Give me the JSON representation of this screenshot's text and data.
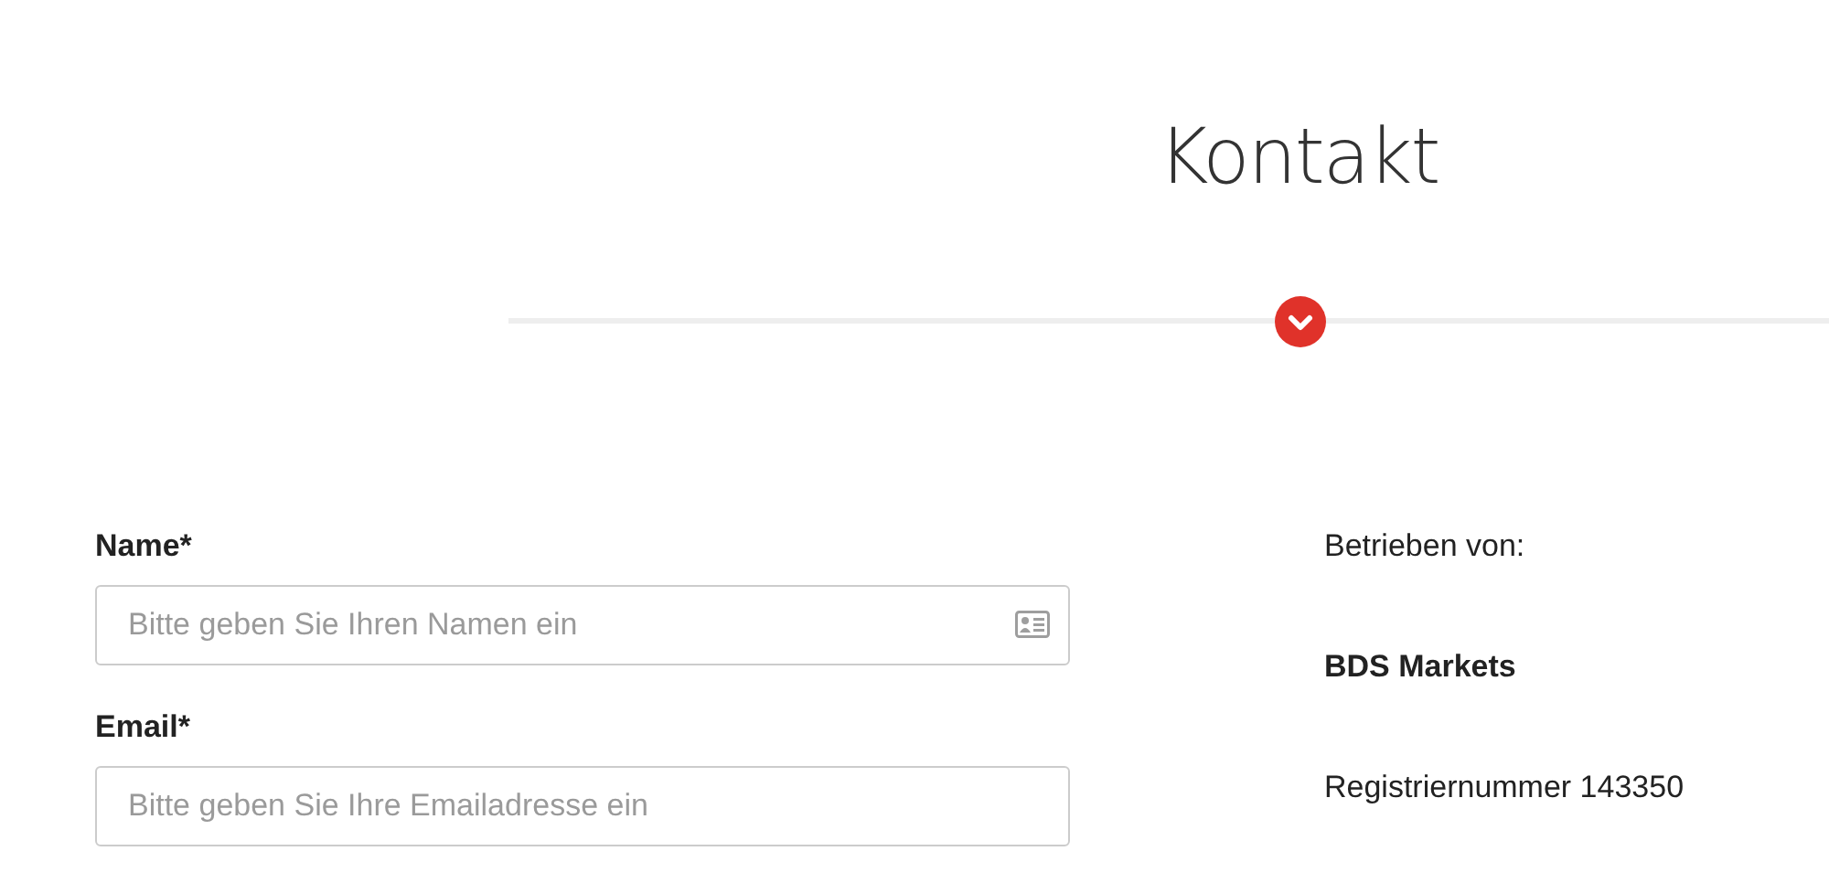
{
  "heading": "Kontakt",
  "form": {
    "fields": [
      {
        "label": "Name*",
        "placeholder": "Bitte geben Sie Ihren Namen ein",
        "kind": "contact-card"
      },
      {
        "label": "Email*",
        "placeholder": "Bitte geben Sie Ihre Emailadresse ein",
        "kind": "plain"
      }
    ]
  },
  "info": [
    "Betrieben von:",
    "**BDS Markets**",
    "Registriernummer 143350"
  ]
}
